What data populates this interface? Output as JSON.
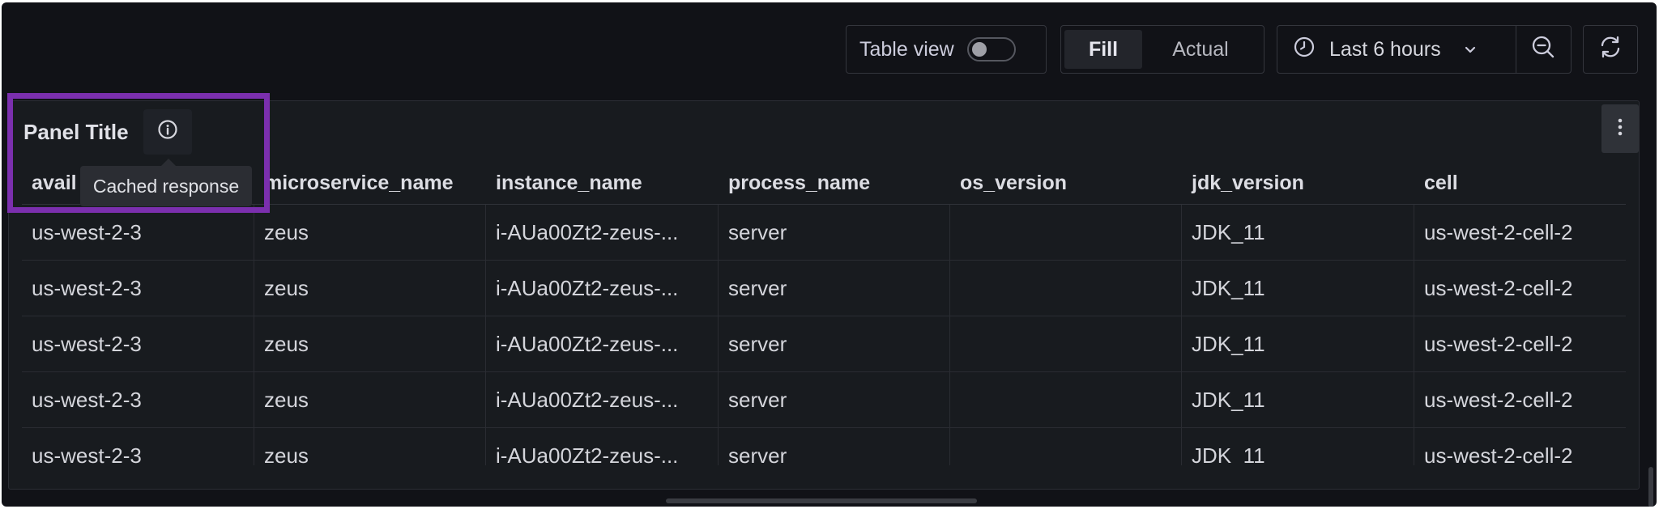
{
  "toolbar": {
    "table_view_label": "Table view",
    "table_view_on": false,
    "fill_label": "Fill",
    "actual_label": "Actual",
    "time_range_label": "Last 6 hours"
  },
  "icons": {
    "clock": "clock-icon",
    "chevron": "chevron-down-icon",
    "zoom_out": "zoom-out-icon",
    "refresh": "refresh-icon",
    "info": "info-icon",
    "menu": "kebab-menu-icon"
  },
  "panel": {
    "title": "Panel Title",
    "tooltip": "Cached response"
  },
  "table": {
    "columns": [
      "avail",
      "microservice_name",
      "instance_name",
      "process_name",
      "os_version",
      "jdk_version",
      "cell"
    ],
    "rows": [
      [
        "us-west-2-3",
        "zeus",
        "i-AUa00Zt2-zeus-...",
        "server",
        "",
        "JDK_11",
        "us-west-2-cell-2"
      ],
      [
        "us-west-2-3",
        "zeus",
        "i-AUa00Zt2-zeus-...",
        "server",
        "",
        "JDK_11",
        "us-west-2-cell-2"
      ],
      [
        "us-west-2-3",
        "zeus",
        "i-AUa00Zt2-zeus-...",
        "server",
        "",
        "JDK_11",
        "us-west-2-cell-2"
      ],
      [
        "us-west-2-3",
        "zeus",
        "i-AUa00Zt2-zeus-...",
        "server",
        "",
        "JDK_11",
        "us-west-2-cell-2"
      ],
      [
        "us-west-2-3",
        "zeus",
        "i-AUa00Zt2-zeus-...",
        "server",
        "",
        "JDK_11",
        "us-west-2-cell-2"
      ]
    ]
  },
  "colors": {
    "background": "#111217",
    "panel": "#181b1f",
    "highlight": "#7b2fae"
  }
}
